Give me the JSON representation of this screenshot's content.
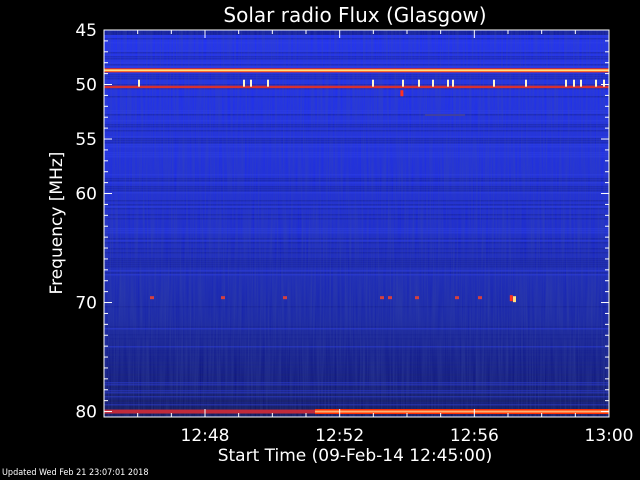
{
  "chart_data": {
    "type": "heatmap",
    "title": "Solar radio Flux (Glasgow)",
    "xlabel": "Start Time (09-Feb-14 12:45:00)",
    "ylabel": "Frequency [MHz]",
    "x_unit": "UT time",
    "y_unit": "MHz",
    "xlim": [
      "12:45",
      "13:00"
    ],
    "ylim": [
      45,
      80.5
    ],
    "x_ticks": [
      {
        "value_min": 3,
        "label": "12:48"
      },
      {
        "value_min": 7,
        "label": "12:52"
      },
      {
        "value_min": 11,
        "label": "12:56"
      },
      {
        "value_min": 15,
        "label": "13:00"
      }
    ],
    "y_ticks": [
      {
        "value": 45,
        "label": "45"
      },
      {
        "value": 50,
        "label": "50"
      },
      {
        "value": 55,
        "label": "55"
      },
      {
        "value": 60,
        "label": "60"
      },
      {
        "value": 70,
        "label": "70"
      },
      {
        "value": 80,
        "label": "80"
      }
    ],
    "colormap": {
      "low": "#00001e",
      "mid": "#1a2dff",
      "high": "#ff3000",
      "peak": "#ffe080"
    },
    "background_level": "low",
    "features": [
      {
        "freq_mhz": 48.7,
        "intensity": "high",
        "kind": "persistent emission line"
      },
      {
        "freq_mhz": 50.2,
        "intensity": "high",
        "kind": "persistent emission line with spikes"
      },
      {
        "freq_mhz": 69.6,
        "intensity": "moderate",
        "kind": "intermittent spikes"
      },
      {
        "freq_mhz": 80.0,
        "intensity": "high",
        "kind": "strong emission band"
      }
    ],
    "bursts": [
      {
        "time": "12:53:50",
        "freq_mhz": 50.8
      },
      {
        "time": "12:57:05",
        "freq_mhz": 69.6
      }
    ]
  },
  "footer": {
    "updated": "Updated Wed Feb 21 23:07:01 2018"
  }
}
